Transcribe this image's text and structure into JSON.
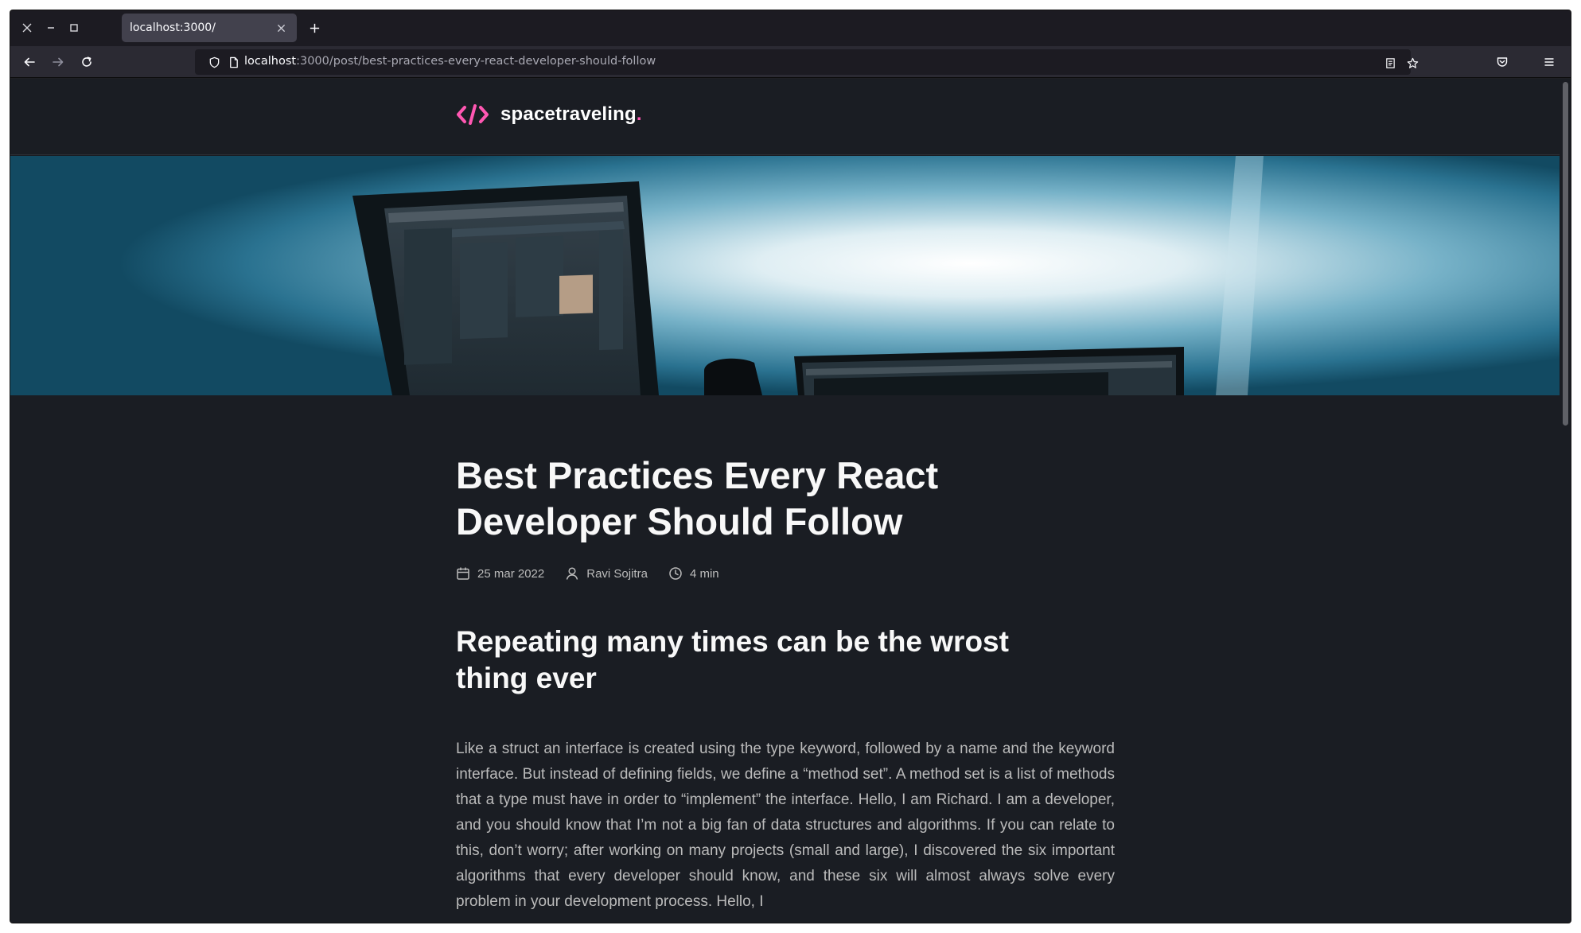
{
  "browser": {
    "tab": {
      "title": "localhost:3000/"
    },
    "url": {
      "host": "localhost",
      "path": ":3000/post/best-practices-every-react-developer-should-follow"
    },
    "icons": {
      "window_close": "close-icon",
      "window_minimize": "minimize-icon",
      "window_maximize": "maximize-icon",
      "back": "arrow-left-icon",
      "forward": "arrow-right-icon",
      "reload": "reload-icon",
      "shield": "shield-icon",
      "page": "page-icon",
      "reader": "reader-view-icon",
      "bookmark": "star-icon",
      "pocket": "pocket-icon",
      "menu": "hamburger-menu-icon"
    }
  },
  "site": {
    "logo_text": "spacetraveling",
    "logo_dot": ".",
    "accent_color": "#ff57b2",
    "background_color": "#1a1d23"
  },
  "post": {
    "title": "Best Practices Every React Developer Should Follow",
    "date": "25 mar 2022",
    "author": "Ravi Sojitra",
    "reading_time": "4 min",
    "section_heading": "Repeating many times can be the wrost thing ever",
    "body": "Like a struct an interface is created using the type keyword, followed by a name and the keyword interface. But instead of defining fields, we define a “method set”. A method set is a list of methods that a type must have in order to “implement” the interface. Hello, I am Richard. I am a developer, and you should know that I’m not a big fan of data structures and algorithms. If you can relate to this, don’t worry; after working on many projects (small and large), I discovered the six important algorithms that every developer should know, and these six will almost always solve every problem in your development process. Hello, I"
  }
}
